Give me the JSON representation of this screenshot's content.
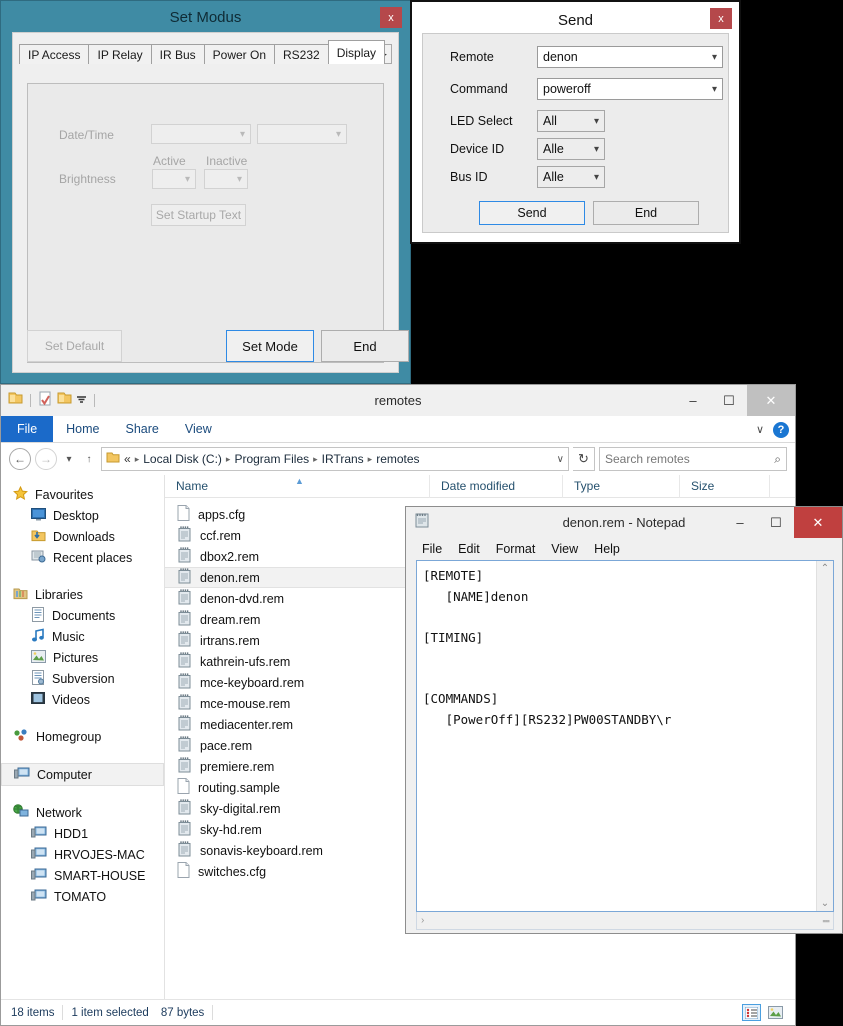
{
  "set_modus": {
    "title": "Set Modus",
    "close_label": "x",
    "tabs": [
      {
        "label": "IP Access",
        "active": false
      },
      {
        "label": "IP Relay",
        "active": false
      },
      {
        "label": "IR Bus",
        "active": false
      },
      {
        "label": "Power On",
        "active": false
      },
      {
        "label": "RS232",
        "active": false
      },
      {
        "label": "Display",
        "active": true
      }
    ],
    "spinner_prev": "◀",
    "spinner_next": "▶",
    "fields": {
      "datetime_label": "Date/Time",
      "datetime_value_1": "",
      "datetime_value_2": "",
      "active_label": "Active",
      "inactive_label": "Inactive",
      "brightness_label": "Brightness",
      "brightness_active": "",
      "brightness_inactive": "",
      "startup_text_button": "Set Startup Text"
    },
    "buttons": {
      "set_default": "Set Default",
      "set_mode": "Set Mode",
      "end": "End"
    }
  },
  "send_dialog": {
    "title": "Send",
    "close_label": "x",
    "rows": [
      {
        "label": "Remote",
        "value": "denon",
        "style": "wide"
      },
      {
        "label": "Command",
        "value": "poweroff",
        "style": "wide"
      },
      {
        "label": "LED Select",
        "value": "All",
        "style": "narrow"
      },
      {
        "label": "Device ID",
        "value": "Alle",
        "style": "narrow"
      },
      {
        "label": "Bus ID",
        "value": "Alle",
        "style": "narrow"
      }
    ],
    "buttons": {
      "send": "Send",
      "end": "End"
    }
  },
  "explorer": {
    "title": "remotes",
    "window_buttons": {
      "minimize": "–",
      "maximize": "☐",
      "close": "✕"
    },
    "ribbon_tabs": [
      "File",
      "Home",
      "Share",
      "View"
    ],
    "ribbon_expand": "∨",
    "help_label": "?",
    "address": {
      "back": "←",
      "forward": "→",
      "recent_chevron": "▾",
      "up": "↑",
      "prefix": "«",
      "crumbs": [
        "Local Disk (C:)",
        "Program Files",
        "IRTrans",
        "remotes"
      ],
      "dropdown": "∨",
      "refresh": "↻"
    },
    "search": {
      "placeholder": "Search remotes",
      "icon": "⌕"
    },
    "nav_pane": [
      {
        "label": "Favourites",
        "icon": "star",
        "level": 0,
        "selected": false
      },
      {
        "label": "Desktop",
        "icon": "desktop",
        "level": 1,
        "selected": false
      },
      {
        "label": "Downloads",
        "icon": "downloads",
        "level": 1,
        "selected": false
      },
      {
        "label": "Recent places",
        "icon": "recent",
        "level": 1,
        "selected": false
      },
      {
        "label": "Libraries",
        "icon": "libraries",
        "level": 0,
        "selected": false,
        "gap_before": true
      },
      {
        "label": "Documents",
        "icon": "documents",
        "level": 1,
        "selected": false
      },
      {
        "label": "Music",
        "icon": "music",
        "level": 1,
        "selected": false
      },
      {
        "label": "Pictures",
        "icon": "pictures",
        "level": 1,
        "selected": false
      },
      {
        "label": "Subversion",
        "icon": "subversion",
        "level": 1,
        "selected": false
      },
      {
        "label": "Videos",
        "icon": "videos",
        "level": 1,
        "selected": false
      },
      {
        "label": "Homegroup",
        "icon": "homegroup",
        "level": 0,
        "selected": false,
        "gap_before": true
      },
      {
        "label": "Computer",
        "icon": "computer",
        "level": 0,
        "selected": true,
        "gap_before": true
      },
      {
        "label": "Network",
        "icon": "network",
        "level": 0,
        "selected": false,
        "gap_before": true
      },
      {
        "label": "HDD1",
        "icon": "pc",
        "level": 1,
        "selected": false
      },
      {
        "label": "HRVOJES-MAC",
        "icon": "pc",
        "level": 1,
        "selected": false
      },
      {
        "label": "SMART-HOUSE",
        "icon": "pc",
        "level": 1,
        "selected": false
      },
      {
        "label": "TOMATO",
        "icon": "pc",
        "level": 1,
        "selected": false
      }
    ],
    "columns": [
      "Name",
      "Date modified",
      "Type",
      "Size"
    ],
    "files": [
      {
        "name": "apps.cfg",
        "icon": "blank",
        "selected": false
      },
      {
        "name": "ccf.rem",
        "icon": "notepad",
        "selected": false
      },
      {
        "name": "dbox2.rem",
        "icon": "notepad",
        "selected": false
      },
      {
        "name": "denon.rem",
        "icon": "notepad",
        "selected": true
      },
      {
        "name": "denon-dvd.rem",
        "icon": "notepad",
        "selected": false
      },
      {
        "name": "dream.rem",
        "icon": "notepad",
        "selected": false
      },
      {
        "name": "irtrans.rem",
        "icon": "notepad",
        "selected": false
      },
      {
        "name": "kathrein-ufs.rem",
        "icon": "notepad",
        "selected": false
      },
      {
        "name": "mce-keyboard.rem",
        "icon": "notepad",
        "selected": false
      },
      {
        "name": "mce-mouse.rem",
        "icon": "notepad",
        "selected": false
      },
      {
        "name": "mediacenter.rem",
        "icon": "notepad",
        "selected": false
      },
      {
        "name": "pace.rem",
        "icon": "notepad",
        "selected": false
      },
      {
        "name": "premiere.rem",
        "icon": "notepad",
        "selected": false
      },
      {
        "name": "routing.sample",
        "icon": "blank",
        "selected": false
      },
      {
        "name": "sky-digital.rem",
        "icon": "notepad",
        "selected": false
      },
      {
        "name": "sky-hd.rem",
        "icon": "notepad",
        "selected": false
      },
      {
        "name": "sonavis-keyboard.rem",
        "icon": "notepad",
        "selected": false
      },
      {
        "name": "switches.cfg",
        "icon": "blank",
        "selected": false
      }
    ],
    "status": {
      "items_count": "18 items",
      "selection": "1 item selected",
      "size": "87 bytes"
    }
  },
  "notepad": {
    "title": "denon.rem - Notepad",
    "window_buttons": {
      "minimize": "–",
      "maximize": "☐",
      "close": "✕"
    },
    "menu": [
      "File",
      "Edit",
      "Format",
      "View",
      "Help"
    ],
    "content": "[REMOTE]\n   [NAME]denon\n\n[TIMING]\n\n\n[COMMANDS]\n   [PowerOff][RS232]PW00STANDBY\\r",
    "scroll": {
      "up": "⌃",
      "down": "⌄",
      "right": "›"
    }
  },
  "colors": {
    "teal_window": "#3f8ba4",
    "close_red": "#b5484b",
    "accent_blue": "#2e8ae5",
    "ribbon_file_blue": "#1b6ac9",
    "notepad_close_red": "#c0403f"
  }
}
